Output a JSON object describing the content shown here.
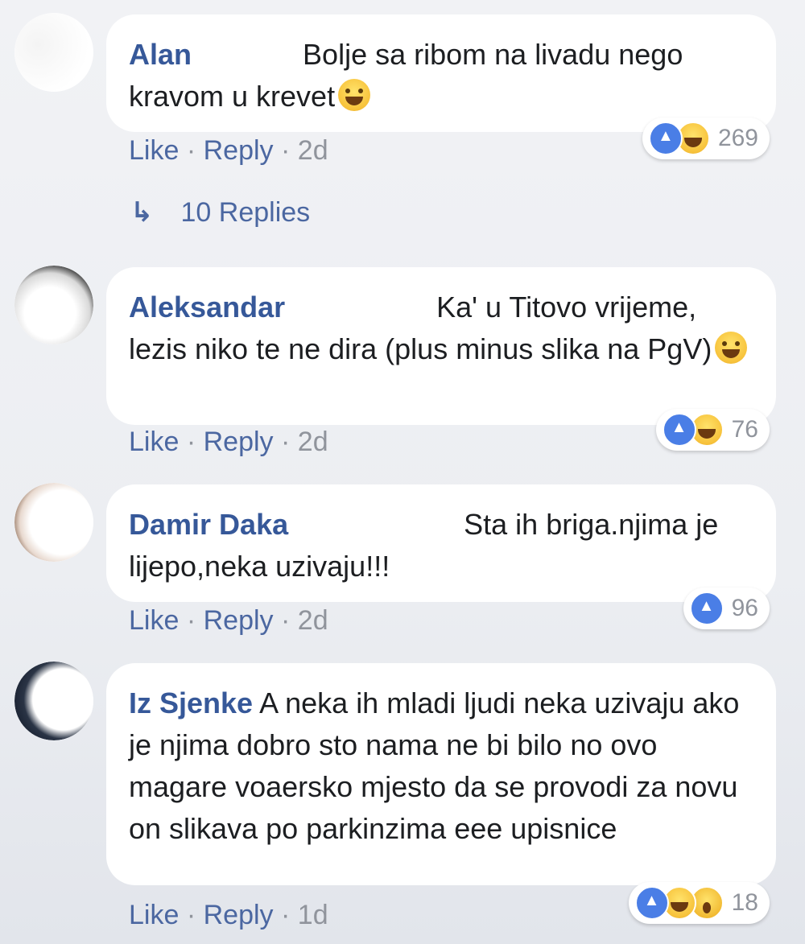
{
  "comments": [
    {
      "author": "Alan",
      "text": "Bolje sa ribom na livadu nego kravom u krevet",
      "emoji": "grinning-squint-emoji",
      "actions": {
        "like": "Like",
        "sep1": "·",
        "reply": "Reply",
        "sep2": "·",
        "age": "2d"
      },
      "reactions": {
        "icons": [
          "like-icon",
          "haha-icon"
        ],
        "count": "269"
      }
    },
    {
      "author": "Aleksandar",
      "text": "Ka' u Titovo vrijeme, lezis niko te ne dira (plus minus slika na PgV)",
      "emoji": "grinning-emoji",
      "actions": {
        "like": "Like",
        "sep1": "·",
        "reply": "Reply",
        "sep2": "·",
        "age": "2d"
      },
      "reactions": {
        "icons": [
          "like-icon",
          "haha-icon"
        ],
        "count": "76"
      }
    },
    {
      "author": "Damir Daka",
      "text": "Sta ih briga.njima je lijepo,neka uzivaju!!!",
      "actions": {
        "like": "Like",
        "sep1": "·",
        "reply": "Reply",
        "sep2": "·",
        "age": "2d"
      },
      "reactions": {
        "icons": [
          "like-icon"
        ],
        "count": "96"
      }
    },
    {
      "author": "Iz Sjenke",
      "text": "A neka ih mladi ljudi neka uzivaju ako je njima dobro sto nama ne bi bilo no ovo magare voaersko mjesto da se provodi za novu on slikava po parkinzima eee upisnice",
      "actions": {
        "like": "Like",
        "sep1": "·",
        "reply": "Reply",
        "sep2": "·",
        "age": "1d"
      },
      "reactions": {
        "icons": [
          "like-icon",
          "haha-icon",
          "wow-icon"
        ],
        "count": "18"
      }
    }
  ],
  "replies_link": {
    "arrow_icon": "reply-arrow-icon",
    "label": "10 Replies"
  },
  "colors": {
    "author": "#365899",
    "link": "#4b67a1",
    "meta": "#90949c",
    "like_blue": "#4a7ee6"
  }
}
